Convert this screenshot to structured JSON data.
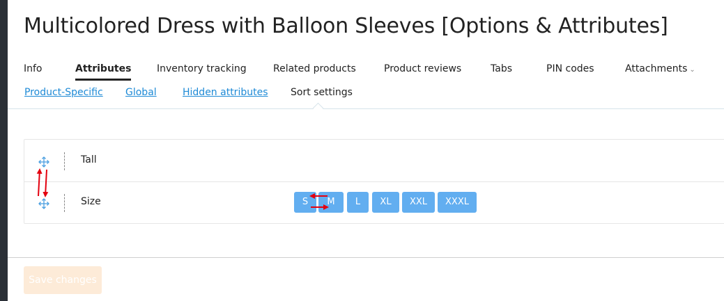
{
  "page_title": "Multicolored Dress with Balloon Sleeves [Options & Attributes]",
  "tabs": [
    {
      "label": "Info"
    },
    {
      "label": "Attributes"
    },
    {
      "label": "Inventory tracking"
    },
    {
      "label": "Related products"
    },
    {
      "label": "Product reviews"
    },
    {
      "label": "Tabs"
    },
    {
      "label": "PIN codes"
    },
    {
      "label": "Attachments",
      "icon": "chevron-down-icon"
    }
  ],
  "active_tab": "Attributes",
  "subtabs": [
    {
      "label": "Product-Specific"
    },
    {
      "label": "Global"
    },
    {
      "label": "Hidden attributes"
    },
    {
      "label": "Sort settings"
    }
  ],
  "active_subtab": "Sort settings",
  "attributes": [
    {
      "name": "Tall",
      "variants": []
    },
    {
      "name": "Size",
      "variants": [
        "S",
        "M",
        "L",
        "XL",
        "XXL",
        "XXXL"
      ]
    }
  ],
  "save_button": {
    "label": "Save changes",
    "state": "disabled"
  },
  "colors": {
    "accent_link": "#1e8ad6",
    "variant_chip": "#62aef0",
    "save_disabled_bg": "#fdebd8",
    "annotation_arrow": "#e3000f",
    "sidebar": "#2b3037"
  }
}
